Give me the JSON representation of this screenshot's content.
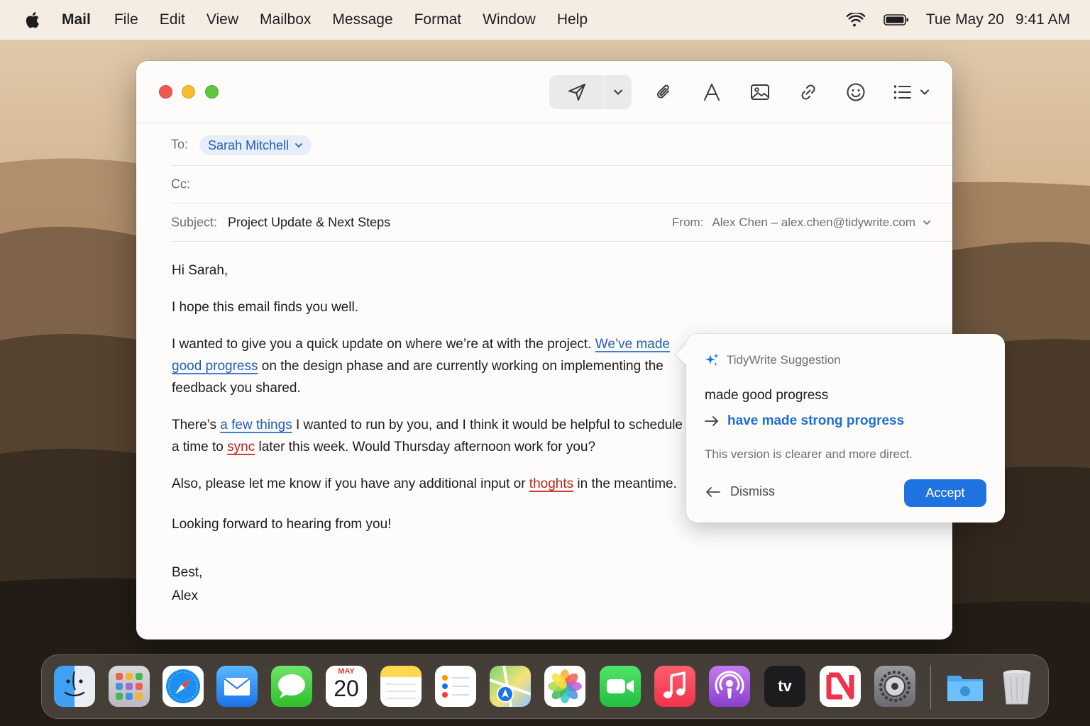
{
  "menubar": {
    "app_name": "Mail",
    "items": [
      "File",
      "Edit",
      "View",
      "Mailbox",
      "Message",
      "Format",
      "Window",
      "Help"
    ],
    "date": "Tue May 20",
    "time": "9:41 AM"
  },
  "compose": {
    "to_label": "To:",
    "to_recipient": "Sarah Mitchell",
    "cc_label": "Cc:",
    "subject_label": "Subject:",
    "subject_value": "Project Update & Next Steps",
    "from_label": "From:",
    "from_value": "Alex Chen – alex.chen@tidywrite.com",
    "body": {
      "greeting": "Hi Sarah,",
      "p1": "I hope this email finds you well.",
      "p2_a": "I wanted to give you a quick update on where we’re at with the project. ",
      "p2_sugg": "We’ve made good progress",
      "p2_b": " on the design phase and are currently working on implementing the feedback you shared.",
      "p3_a": "There’s ",
      "p3_sugg": "a few things",
      "p3_b": " I wanted to run by you, and I think it would be helpful to schedule a time to ",
      "p3_err": "sync",
      "p3_c": " later this week. Would Thursday afternoon work for you?",
      "p4_a": "Also, please let me know if you have any additional input or ",
      "p4_err": "thoghts",
      "p4_b": " in the meantime.",
      "p5": "Looking forward to hearing from you!",
      "signoff": "Best,",
      "signature": "Alex"
    }
  },
  "suggestion": {
    "title": "TidyWrite Suggestion",
    "original": "made good progress",
    "replacement": "have made strong progress",
    "explanation": "This version is clearer and more direct.",
    "dismiss_label": "Dismiss",
    "accept_label": "Accept"
  },
  "dock": {
    "apps": [
      "finder-icon",
      "launchpad-icon",
      "safari-icon",
      "mail-icon",
      "messages-icon",
      "calendar-icon",
      "notes-icon",
      "reminders-icon",
      "maps-icon",
      "photos-icon",
      "facetime-icon",
      "music-icon",
      "podcasts-icon",
      "tv-icon",
      "news-icon",
      "settings-icon",
      "downloads-folder-icon",
      "trash-icon"
    ],
    "calendar_month": "MAY",
    "calendar_day": "20",
    "tv_label": "tv"
  },
  "colors": {
    "accent": "#1f73e0",
    "suggestion_link": "#1f5fb4",
    "error": "#b3261e"
  }
}
